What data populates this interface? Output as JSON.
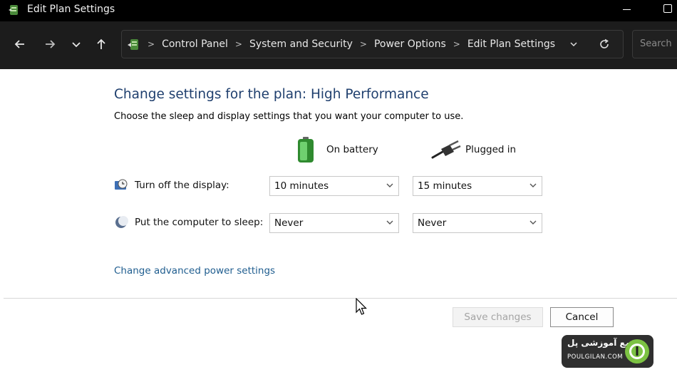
{
  "window": {
    "title": "Edit Plan Settings"
  },
  "nav": {
    "back_icon": "arrow-left",
    "forward_icon": "arrow-right",
    "recent_icon": "chevron-down",
    "up_icon": "arrow-up"
  },
  "address": {
    "breadcrumbs": [
      "Control Panel",
      "System and Security",
      "Power Options",
      "Edit Plan Settings"
    ],
    "search_placeholder": "Search"
  },
  "main": {
    "heading": "Change settings for the plan: High Performance",
    "subheading": "Choose the sleep and display settings that you want your computer to use.",
    "columns": {
      "battery": "On battery",
      "plugged": "Plugged in"
    },
    "rows": [
      {
        "label": "Turn off the display:",
        "battery": "10 minutes",
        "plugged": "15 minutes"
      },
      {
        "label": "Put the computer to sleep:",
        "battery": "Never",
        "plugged": "Never"
      }
    ],
    "advanced_link": "Change advanced power settings"
  },
  "footer": {
    "save_label": "Save changes",
    "cancel_label": "Cancel"
  },
  "watermark": {
    "text_fa": "مجتمع آموزشی پل",
    "text_en": "POULGILAN.COM"
  },
  "colors": {
    "heading": "#1f3f6e",
    "link": "#1f5d8f",
    "battery_green": "#3aa23a",
    "watermark_green": "#7cc243"
  }
}
